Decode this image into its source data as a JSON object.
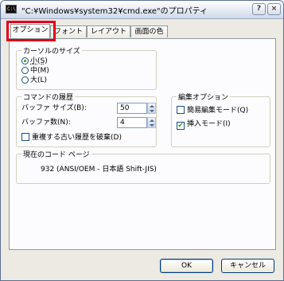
{
  "window": {
    "title": "\"C:¥Windows¥system32¥cmd.exe\"のプロパティ",
    "icon_text": "C:\\",
    "help_label": "?",
    "close_label": "×"
  },
  "tabs": [
    {
      "label": "オプション",
      "active": true
    },
    {
      "label": "フォント",
      "active": false
    },
    {
      "label": "レイアウト",
      "active": false
    },
    {
      "label": "画面の色",
      "active": false
    }
  ],
  "cursor_size": {
    "label": "カーソルのサイズ",
    "options": [
      {
        "label": "小(S)",
        "selected": true
      },
      {
        "label": "中(M)",
        "selected": false
      },
      {
        "label": "大(L)",
        "selected": false
      }
    ]
  },
  "command_history": {
    "label": "コマンドの履歴",
    "buffer_size_label": "バッファ サイズ(B):",
    "buffer_size_value": "50",
    "buffer_count_label": "バッファ数(N):",
    "buffer_count_value": "4",
    "discard_old_label": "重複する古い履歴を破棄(D)",
    "discard_old_checked": false
  },
  "edit_options": {
    "label": "編集オプション",
    "quick_edit_label": "簡易編集モード(Q)",
    "quick_edit_checked": false,
    "insert_mode_label": "挿入モード(I)",
    "insert_mode_checked": true
  },
  "code_page": {
    "label": "現在のコード ページ",
    "value": "932  (ANSI/OEM - 日本語 Shift-JIS)"
  },
  "buttons": {
    "ok_label": "OK",
    "cancel_label": "キャンセル"
  },
  "colors": {
    "highlight": "#e0001a",
    "radio_dot": "#21a121",
    "check_mark": "#21a121"
  }
}
